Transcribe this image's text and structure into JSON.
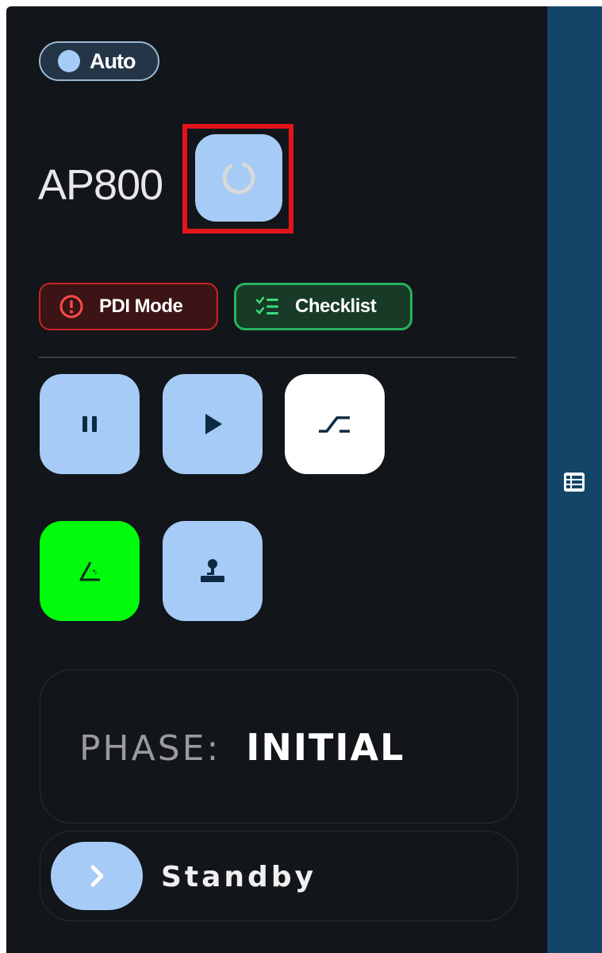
{
  "auto_toggle": {
    "label": "Auto",
    "state": "on"
  },
  "header": {
    "title": "AP800",
    "refresh_icon": "loading-ring-icon"
  },
  "chips": {
    "pdi": {
      "label": "PDI Mode",
      "icon": "alert-circle-icon",
      "color": "#c72428"
    },
    "checklist": {
      "label": "Checklist",
      "icon": "checklist-icon",
      "color": "#27b25e"
    }
  },
  "controls": [
    {
      "name": "pause-button",
      "icon": "pause-icon",
      "style": "blue"
    },
    {
      "name": "play-button",
      "icon": "play-icon",
      "style": "blue"
    },
    {
      "name": "ramp-button",
      "icon": "ramp-icon",
      "style": "white"
    },
    {
      "name": "angle-button",
      "icon": "angle-icon",
      "style": "green"
    },
    {
      "name": "joystick-button",
      "icon": "joystick-icon",
      "style": "blue"
    }
  ],
  "phase": {
    "key": "PHASE:",
    "value": "INITIAL"
  },
  "standby": {
    "label": "Standby",
    "icon": "chevron-right-icon"
  },
  "sidebar": {
    "icon": "list-view-icon"
  },
  "colors": {
    "panel_bg": "#121519",
    "sidebar_bg": "#134568",
    "button_blue": "#a6cbf6",
    "button_green": "#00fb0c",
    "highlight": "#e2151b"
  }
}
